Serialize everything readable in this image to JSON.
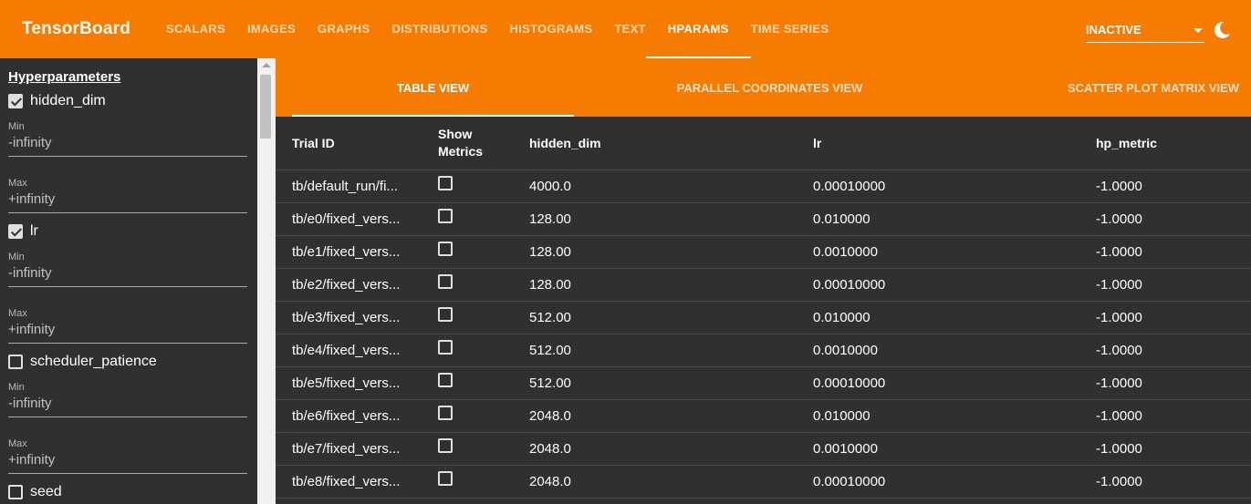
{
  "app": {
    "title": "TensorBoard",
    "nav_tabs": [
      {
        "label": "SCALARS"
      },
      {
        "label": "IMAGES"
      },
      {
        "label": "GRAPHS"
      },
      {
        "label": "DISTRIBUTIONS"
      },
      {
        "label": "HISTOGRAMS"
      },
      {
        "label": "TEXT"
      },
      {
        "label": "HPARAMS",
        "active": true
      },
      {
        "label": "TIME SERIES"
      }
    ],
    "run_select": "INACTIVE",
    "theme_icon": "moon-icon",
    "accent_color": "#f57c00"
  },
  "sidebar": {
    "title": "Hyperparameters",
    "params": [
      {
        "name": "hidden_dim",
        "checked": true,
        "min_label": "Min",
        "min_value": "-infinity",
        "max_label": "Max",
        "max_value": "+infinity"
      },
      {
        "name": "lr",
        "checked": true,
        "min_label": "Min",
        "min_value": "-infinity",
        "max_label": "Max",
        "max_value": "+infinity"
      },
      {
        "name": "scheduler_patience",
        "checked": false,
        "min_label": "Min",
        "min_value": "-infinity",
        "max_label": "Max",
        "max_value": "+infinity"
      },
      {
        "name": "seed",
        "checked": false
      }
    ]
  },
  "view_tabs": [
    {
      "label": "TABLE VIEW",
      "active": true
    },
    {
      "label": "PARALLEL COORDINATES VIEW"
    },
    {
      "label": "SCATTER PLOT MATRIX VIEW"
    }
  ],
  "table": {
    "headers": {
      "trial_id": "Trial ID",
      "show_metrics": "Show Metrics",
      "hidden_dim": "hidden_dim",
      "lr": "lr",
      "hp_metric": "hp_metric"
    },
    "rows": [
      {
        "trial_id": "tb/default_run/fi...",
        "hidden_dim": "4000.0",
        "lr": "0.00010000",
        "hp_metric": "-1.0000"
      },
      {
        "trial_id": "tb/e0/fixed_vers...",
        "hidden_dim": "128.00",
        "lr": "0.010000",
        "hp_metric": "-1.0000"
      },
      {
        "trial_id": "tb/e1/fixed_vers...",
        "hidden_dim": "128.00",
        "lr": "0.0010000",
        "hp_metric": "-1.0000"
      },
      {
        "trial_id": "tb/e2/fixed_vers...",
        "hidden_dim": "128.00",
        "lr": "0.00010000",
        "hp_metric": "-1.0000"
      },
      {
        "trial_id": "tb/e3/fixed_vers...",
        "hidden_dim": "512.00",
        "lr": "0.010000",
        "hp_metric": "-1.0000"
      },
      {
        "trial_id": "tb/e4/fixed_vers...",
        "hidden_dim": "512.00",
        "lr": "0.0010000",
        "hp_metric": "-1.0000"
      },
      {
        "trial_id": "tb/e5/fixed_vers...",
        "hidden_dim": "512.00",
        "lr": "0.00010000",
        "hp_metric": "-1.0000"
      },
      {
        "trial_id": "tb/e6/fixed_vers...",
        "hidden_dim": "2048.0",
        "lr": "0.010000",
        "hp_metric": "-1.0000"
      },
      {
        "trial_id": "tb/e7/fixed_vers...",
        "hidden_dim": "2048.0",
        "lr": "0.0010000",
        "hp_metric": "-1.0000"
      },
      {
        "trial_id": "tb/e8/fixed_vers...",
        "hidden_dim": "2048.0",
        "lr": "0.00010000",
        "hp_metric": "-1.0000"
      }
    ]
  }
}
